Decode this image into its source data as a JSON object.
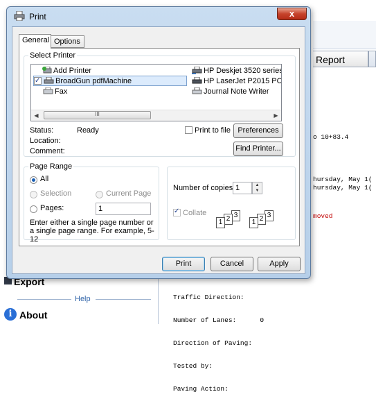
{
  "background_app": {
    "report_tab": "Report",
    "line_station": "o 10+83.4",
    "line_date_1": "hursday, May 1(",
    "line_date_2": "hursday, May 1(",
    "line_removed": "moved",
    "export_label": "Export",
    "help_label": "Help",
    "about_label": "About",
    "report_lines": [
      "Traffic Direction:",
      "Number of Lanes:      0",
      "Direction of Paving:",
      "Tested by:",
      "Paving Action:"
    ]
  },
  "dialog": {
    "title": "Print",
    "close_symbol": "x",
    "tabs": [
      {
        "label": "General",
        "active": true
      },
      {
        "label": "Options",
        "active": false
      }
    ],
    "select_printer": {
      "legend": "Select Printer",
      "printers": [
        {
          "label": "Add Printer",
          "icon": "add-printer-icon",
          "selected": false
        },
        {
          "label": "BroadGun pdfMachine",
          "icon": "printer-icon",
          "selected": true,
          "default": true
        },
        {
          "label": "Fax",
          "icon": "fax-icon",
          "selected": false
        },
        {
          "label": "HP Deskjet 3520 series",
          "icon": "network-printer-icon",
          "selected": false
        },
        {
          "label": "HP LaserJet P2015 PCL",
          "icon": "printer-icon",
          "selected": false
        },
        {
          "label": "Journal Note Writer",
          "icon": "printer-icon",
          "selected": false
        }
      ],
      "scroll_grip": "III",
      "status_label": "Status:",
      "status_value": "Ready",
      "location_label": "Location:",
      "comment_label": "Comment:",
      "print_to_file_label": "Print to file",
      "print_to_file_checked": false,
      "preferences_button": "Preferences",
      "find_printer_button": "Find Printer..."
    },
    "page_range": {
      "legend": "Page Range",
      "all_label": "All",
      "selection_label": "Selection",
      "current_page_label": "Current Page",
      "pages_label": "Pages:",
      "pages_value": "1",
      "selected": "all",
      "hint": "Enter either a single page number or a single page range.  For example, 5-12"
    },
    "copies": {
      "number_label": "Number of copies:",
      "number_value": "1",
      "collate_label": "Collate",
      "collate_checked": true,
      "collate_pages": [
        "1",
        "2",
        "3",
        "1",
        "2",
        "3"
      ]
    },
    "buttons": {
      "print": "Print",
      "cancel": "Cancel",
      "apply": "Apply"
    },
    "colors": {
      "frame": "#b6cfe9",
      "close_button": "#c6432c",
      "selection": "#dcebfc"
    }
  }
}
